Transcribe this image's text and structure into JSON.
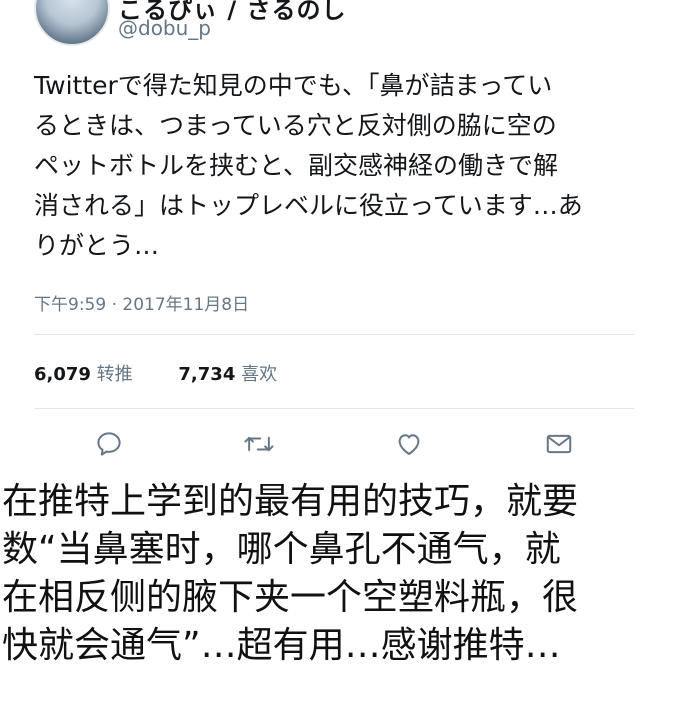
{
  "tweet": {
    "name_partial": "こるぴぃ / さるのし",
    "handle": "@dobu_p",
    "text": "Twitterで得た知見の中でも、「鼻が詰まってい\nるときは、つまっている穴と反対側の脇に空の\nペットボトルを挟むと、副交感神経の働きで解\n消される」はトップレベルに役立っています…あ\nりがとう…",
    "timestamp": "下午9:59 · 2017年11月8日",
    "retweets_count": "6,079",
    "retweets_label": "转推",
    "likes_count": "7,734",
    "likes_label": "喜欢",
    "actions": [
      {
        "icon": "reply-icon"
      },
      {
        "icon": "retweet-icon"
      },
      {
        "icon": "like-icon"
      },
      {
        "icon": "message-icon"
      }
    ]
  },
  "caption": {
    "text": "在推特上学到的最有用的技巧，就要\n数“当鼻塞时，哪个鼻孔不通气，就\n在相反侧的腋下夹一个空塑料瓶，很\n快就会通气”…超有用…感谢推特…"
  },
  "colors": {
    "text": "#14171a",
    "secondary": "#657786",
    "divider": "#e1e8ed"
  }
}
